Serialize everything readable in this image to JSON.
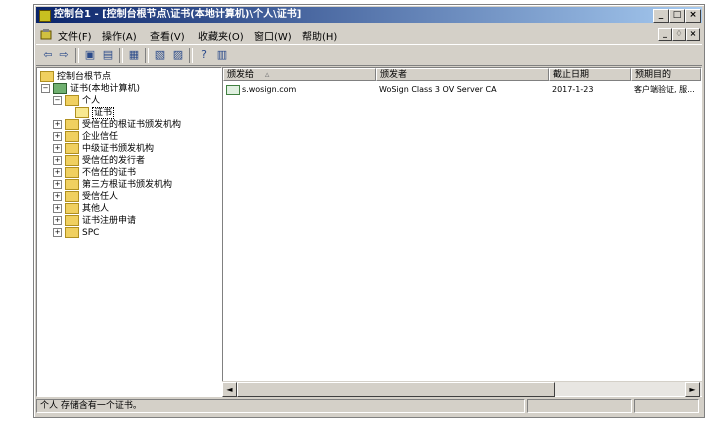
{
  "window": {
    "title": "控制台1 - [控制台根节点\\证书(本地计算机)\\个人\\证书]",
    "controls": [
      "_",
      "□",
      "×"
    ]
  },
  "menu": {
    "items": [
      "文件(F)",
      "操作(A)",
      "查看(V)",
      "收藏夹(O)",
      "窗口(W)",
      "帮助(H)"
    ],
    "mdi_controls": [
      "_",
      "♢",
      "×"
    ]
  },
  "toolbar": {
    "icons": [
      "back-icon",
      "forward-icon",
      "up-folder-icon",
      "show-tree-icon",
      "delete-icon",
      "properties-icon",
      "export-icon",
      "help-icon",
      "view-icon"
    ]
  },
  "tree": {
    "root": "控制台根节点",
    "computer": "证书(本地计算机)",
    "personal": "个人",
    "certs": "证书",
    "items": [
      "受信任的根证书颁发机构",
      "企业信任",
      "中级证书颁发机构",
      "受信任的发行者",
      "不信任的证书",
      "第三方根证书颁发机构",
      "受信任人",
      "其他人",
      "证书注册申请",
      "SPC"
    ]
  },
  "list": {
    "columns": [
      "颁发给",
      "颁发者",
      "截止日期",
      "预期目的"
    ],
    "rows": [
      {
        "issued_to": "s.wosign.com",
        "issuer": "WoSign Class 3 OV Server CA",
        "expires": "2017-1-23",
        "purpose": "客户端验证, 服..."
      }
    ]
  },
  "status": {
    "text": "个人 存储含有一个证书。"
  }
}
